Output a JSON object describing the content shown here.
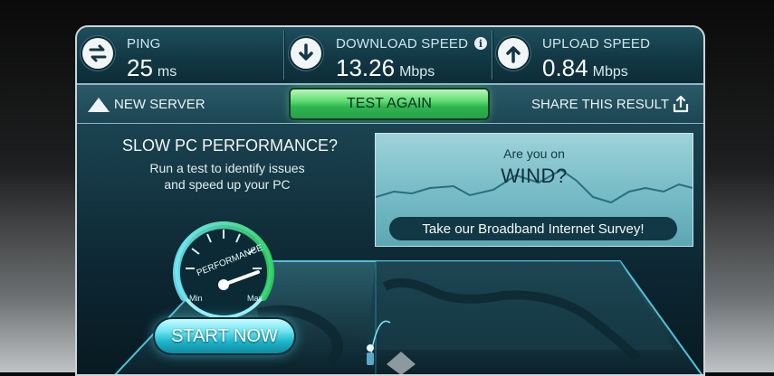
{
  "stats": {
    "ping": {
      "label": "PING",
      "value": "25",
      "unit": "ms",
      "icon": "ping-arrows-icon"
    },
    "download": {
      "label": "DOWNLOAD SPEED",
      "value": "13.26",
      "unit": "Mbps",
      "icon": "download-arrow-icon",
      "info_icon": "i"
    },
    "upload": {
      "label": "UPLOAD SPEED",
      "value": "0.84",
      "unit": "Mbps",
      "icon": "upload-arrow-icon"
    }
  },
  "actions": {
    "new_server": "NEW SERVER",
    "test_again": "TEST AGAIN",
    "share": "SHARE THIS RESULT"
  },
  "promo": {
    "title": "SLOW PC PERFORMANCE?",
    "line1": "Run a test to identify issues",
    "line2": "and speed up your PC",
    "gauge_label": "PERFORMANCE",
    "gauge_min": "Min",
    "gauge_max": "Max",
    "start_button": "START NOW"
  },
  "survey": {
    "question": "Are you on",
    "isp": "WIND?",
    "button": "Take our Broadband Internet Survey!"
  },
  "colors": {
    "accent_green": "#2fb550",
    "accent_cyan": "#1fb6cb",
    "panel_dark": "#123845"
  }
}
